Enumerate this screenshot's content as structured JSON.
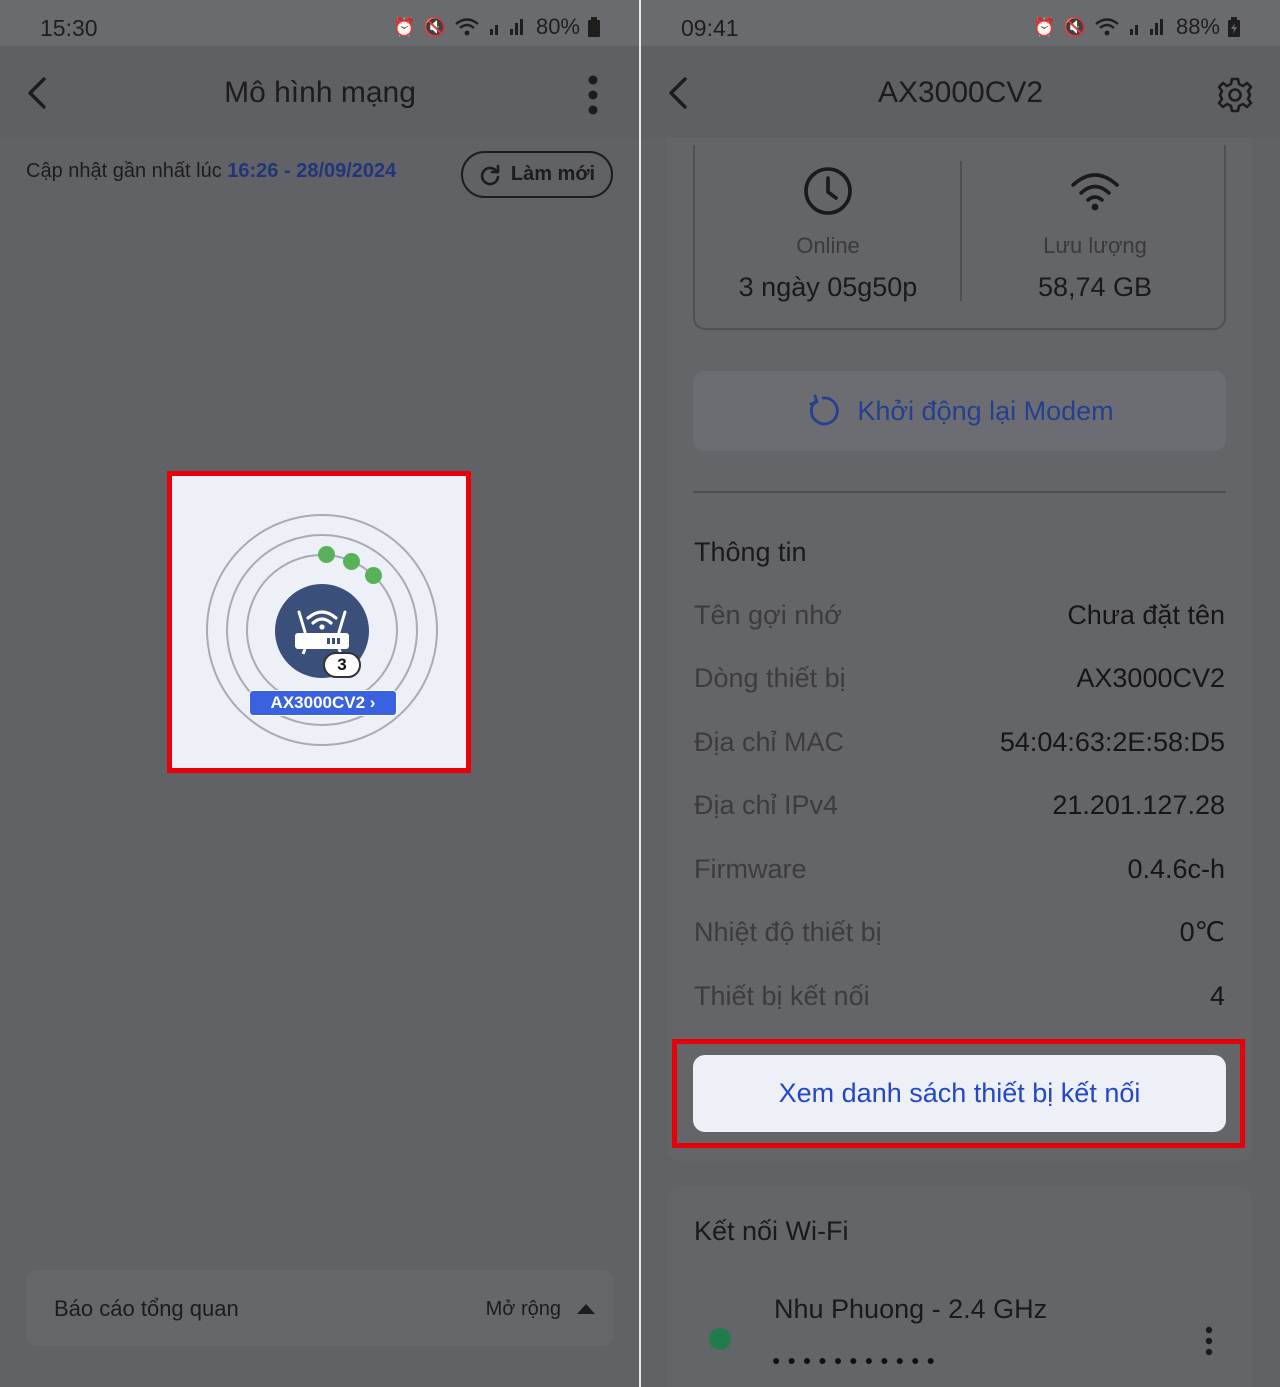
{
  "left_screen": {
    "status_bar": {
      "time": "15:30",
      "battery": "80%"
    },
    "app_bar": {
      "title": "Mô hình mạng"
    },
    "update": {
      "prefix": "Cập nhật gần nhất lúc ",
      "timestamp": "16:26 - 28/09/2024"
    },
    "refresh_button": {
      "label": "Làm mới"
    },
    "topology": {
      "device_name": "AX3000CV2 ›",
      "client_count": "3"
    },
    "report_bar": {
      "label": "Báo cáo tổng quan",
      "expand_label": "Mở rộng"
    }
  },
  "right_screen": {
    "status_bar": {
      "time": "09:41",
      "battery": "88%"
    },
    "app_bar": {
      "title": "AX3000CV2"
    },
    "stats": [
      {
        "label": "Online",
        "value": "3 ngày 05g50p",
        "icon": "clock-icon"
      },
      {
        "label": "Lưu lượng",
        "value": "58,74 GB",
        "icon": "wifi-icon"
      }
    ],
    "restart_button": {
      "label": "Khởi động lại Modem"
    },
    "info_section": {
      "title": "Thông tin",
      "rows": [
        {
          "key": "Tên gợi nhớ",
          "value": "Chưa đặt tên"
        },
        {
          "key": "Dòng thiết bị",
          "value": "AX3000CV2"
        },
        {
          "key": "Địa chỉ MAC",
          "value": "54:04:63:2E:58:D5"
        },
        {
          "key": "Địa chỉ IPv4",
          "value": "21.201.127.28"
        },
        {
          "key": "Firmware",
          "value": "0.4.6c-h"
        },
        {
          "key": "Nhiệt độ thiết bị",
          "value": "0℃"
        },
        {
          "key": "Thiết bị kết nối",
          "value": "4"
        }
      ]
    },
    "list_button": {
      "label": "Xem danh sách thiết bị kết nối"
    },
    "wifi_section": {
      "title": "Kết nối Wi-Fi",
      "networks": [
        {
          "name": "Nhu Phuong - 2.4 GHz",
          "password_mask": "●●●●●●●●●●●"
        }
      ]
    }
  },
  "colors": {
    "highlight": "#e8000b",
    "accent": "#2447c9",
    "badge_blue": "#3a62e0",
    "online_green": "#58b25c"
  }
}
